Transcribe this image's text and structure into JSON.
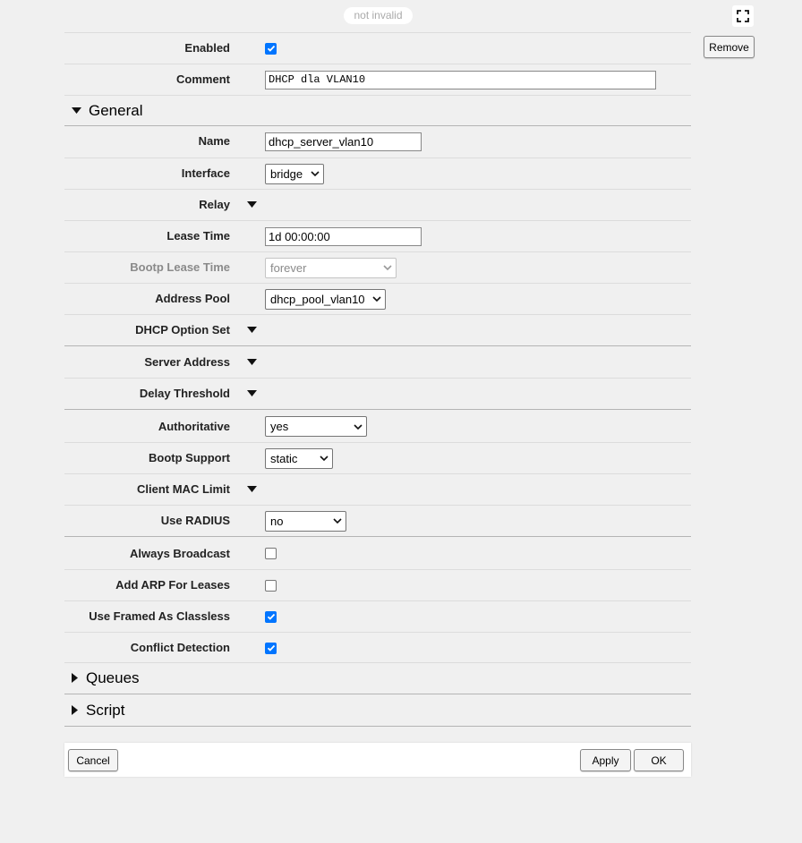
{
  "status": "not invalid",
  "remove_label": "Remove",
  "fields": {
    "enabled": {
      "label": "Enabled",
      "checked": true
    },
    "comment": {
      "label": "Comment",
      "value": "DHCP dla VLAN10"
    }
  },
  "general": {
    "title": "General",
    "name": {
      "label": "Name",
      "value": "dhcp_server_vlan10"
    },
    "interface": {
      "label": "Interface",
      "value": "bridge"
    },
    "relay": {
      "label": "Relay"
    },
    "lease_time": {
      "label": "Lease Time",
      "value": "1d 00:00:00"
    },
    "bootp_lease_time": {
      "label": "Bootp Lease Time",
      "value": "forever"
    },
    "address_pool": {
      "label": "Address Pool",
      "value": "dhcp_pool_vlan10"
    },
    "dhcp_option_set": {
      "label": "DHCP Option Set"
    },
    "server_address": {
      "label": "Server Address"
    },
    "delay_threshold": {
      "label": "Delay Threshold"
    },
    "authoritative": {
      "label": "Authoritative",
      "value": "yes"
    },
    "bootp_support": {
      "label": "Bootp Support",
      "value": "static"
    },
    "client_mac_limit": {
      "label": "Client MAC Limit"
    },
    "use_radius": {
      "label": "Use RADIUS",
      "value": "no"
    },
    "always_broadcast": {
      "label": "Always Broadcast",
      "checked": false
    },
    "add_arp_for_leases": {
      "label": "Add ARP For Leases",
      "checked": false
    },
    "use_framed_as_classless": {
      "label": "Use Framed As Classless",
      "checked": true
    },
    "conflict_detection": {
      "label": "Conflict Detection",
      "checked": true
    }
  },
  "queues": {
    "title": "Queues"
  },
  "script": {
    "title": "Script"
  },
  "footer": {
    "cancel": "Cancel",
    "apply": "Apply",
    "ok": "OK"
  },
  "colors": {
    "checkbox_accent": "#0075ff",
    "background": "#f0f0f0"
  },
  "icons": {
    "fullscreen": "fullscreen-icon",
    "expand": "triangle-down-icon",
    "collapsed": "triangle-right-icon"
  }
}
